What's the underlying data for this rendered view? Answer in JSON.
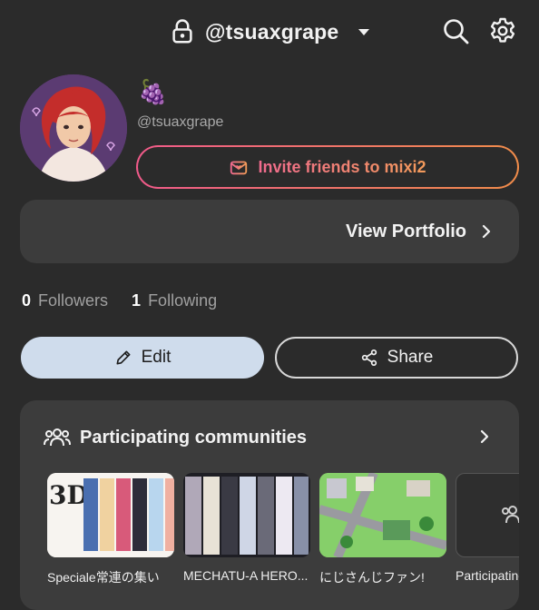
{
  "header": {
    "account_name": "@tsuaxgrape",
    "icons": [
      "lock-icon",
      "caret-down-icon",
      "search-icon",
      "gear-icon"
    ]
  },
  "profile": {
    "emoji": "🍇",
    "handle": "@tsuaxgrape",
    "invite_label": "Invite friends to mixi2",
    "portfolio_label": "View Portfolio"
  },
  "stats": {
    "followers_count": "0",
    "followers_label": "Followers",
    "following_count": "1",
    "following_label": "Following"
  },
  "actions": {
    "edit_label": "Edit",
    "share_label": "Share"
  },
  "communities": {
    "title": "Participating communities",
    "items": [
      {
        "name": "Speciale常連の集い"
      },
      {
        "name": "MECHATU-A HERO..."
      },
      {
        "name": "にじさんじファン!"
      },
      {
        "name": "Participating"
      }
    ]
  },
  "colors": {
    "background": "#2b2b2b",
    "card": "#3c3c3c",
    "edit_button": "#cfdcec",
    "invite_gradient_start": "#f05a8a",
    "invite_gradient_end": "#f08c4a"
  }
}
